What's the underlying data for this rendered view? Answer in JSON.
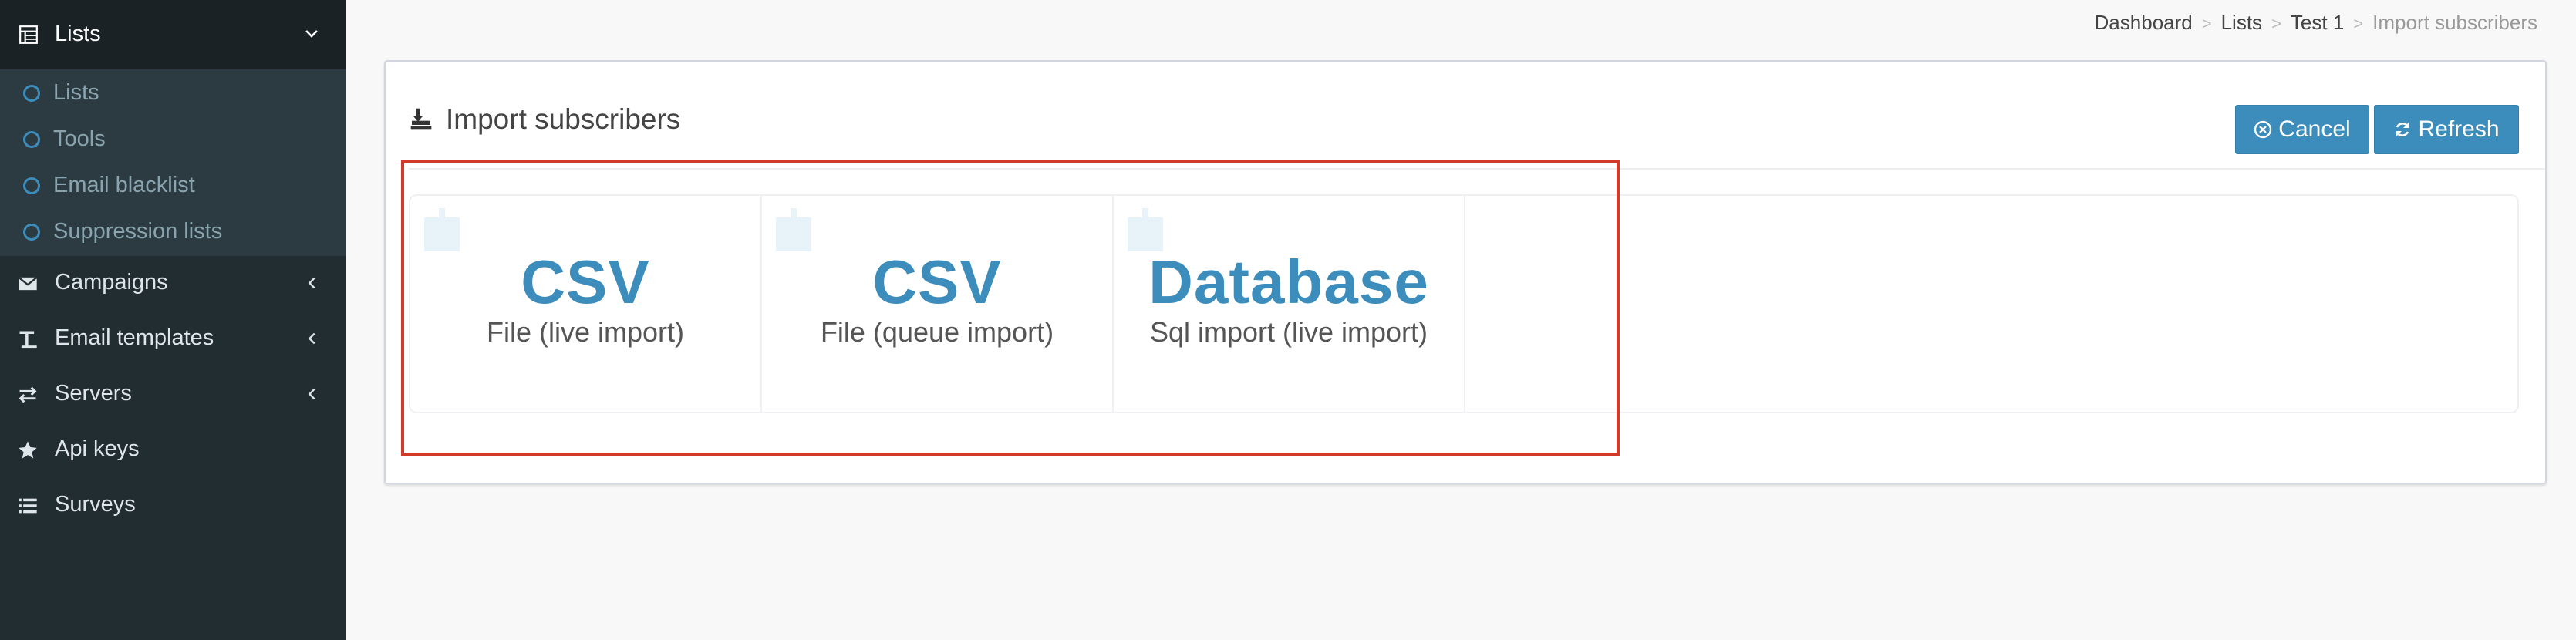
{
  "sidebar": {
    "active_menu": {
      "label": "Lists",
      "icon": "table-icon"
    },
    "submenu": [
      {
        "label": "Lists"
      },
      {
        "label": "Tools"
      },
      {
        "label": "Email blacklist"
      },
      {
        "label": "Suppression lists"
      }
    ],
    "items": [
      {
        "label": "Campaigns",
        "icon": "envelope-icon"
      },
      {
        "label": "Email templates",
        "icon": "text-height-icon"
      },
      {
        "label": "Servers",
        "icon": "exchange-icon"
      },
      {
        "label": "Api keys",
        "icon": "star-icon"
      },
      {
        "label": "Surveys",
        "icon": "list-icon"
      }
    ]
  },
  "breadcrumb": {
    "items": [
      "Dashboard",
      "Lists",
      "Test 1"
    ],
    "current": "Import subscribers",
    "separator": ">"
  },
  "box": {
    "title": "Import subscribers",
    "buttons": {
      "cancel": "Cancel",
      "refresh": "Refresh"
    }
  },
  "import_options": [
    {
      "title": "CSV",
      "subtitle": "File (live import)"
    },
    {
      "title": "CSV",
      "subtitle": "File (queue import)"
    },
    {
      "title": "Database",
      "subtitle": "Sql import (live import)"
    }
  ],
  "colors": {
    "accent": "#3c8dbc",
    "sidebar_bg": "#222d32",
    "highlight": "#d33a2a"
  }
}
